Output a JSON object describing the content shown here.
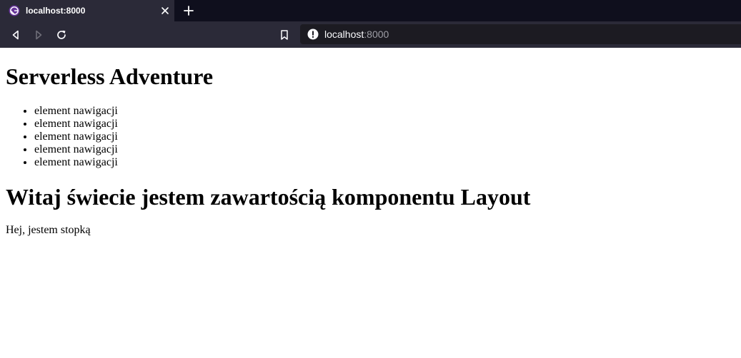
{
  "browser": {
    "tab_title": "localhost:8000",
    "url_host": "localhost",
    "url_port": ":8000",
    "icons": {
      "favicon": "gatsby-icon",
      "close": "close-icon",
      "new_tab": "plus-icon",
      "back": "back-arrow-icon",
      "forward": "forward-arrow-icon",
      "reload": "reload-icon",
      "bookmark": "bookmark-icon",
      "site_info": "info-icon"
    },
    "colors": {
      "tab_strip": "#0f0f1d",
      "toolbar": "#2b2a38",
      "urlbar": "#1c1b22",
      "favicon_accent": "#663399"
    }
  },
  "page": {
    "site_title": "Serverless Adventure",
    "nav_items": [
      "element nawigacji",
      "element nawigacji",
      "element nawigacji",
      "element nawigacji",
      "element nawigacji"
    ],
    "heading": "Witaj świecie jestem zawartością komponentu Layout",
    "footer": "Hej, jestem stopką"
  }
}
